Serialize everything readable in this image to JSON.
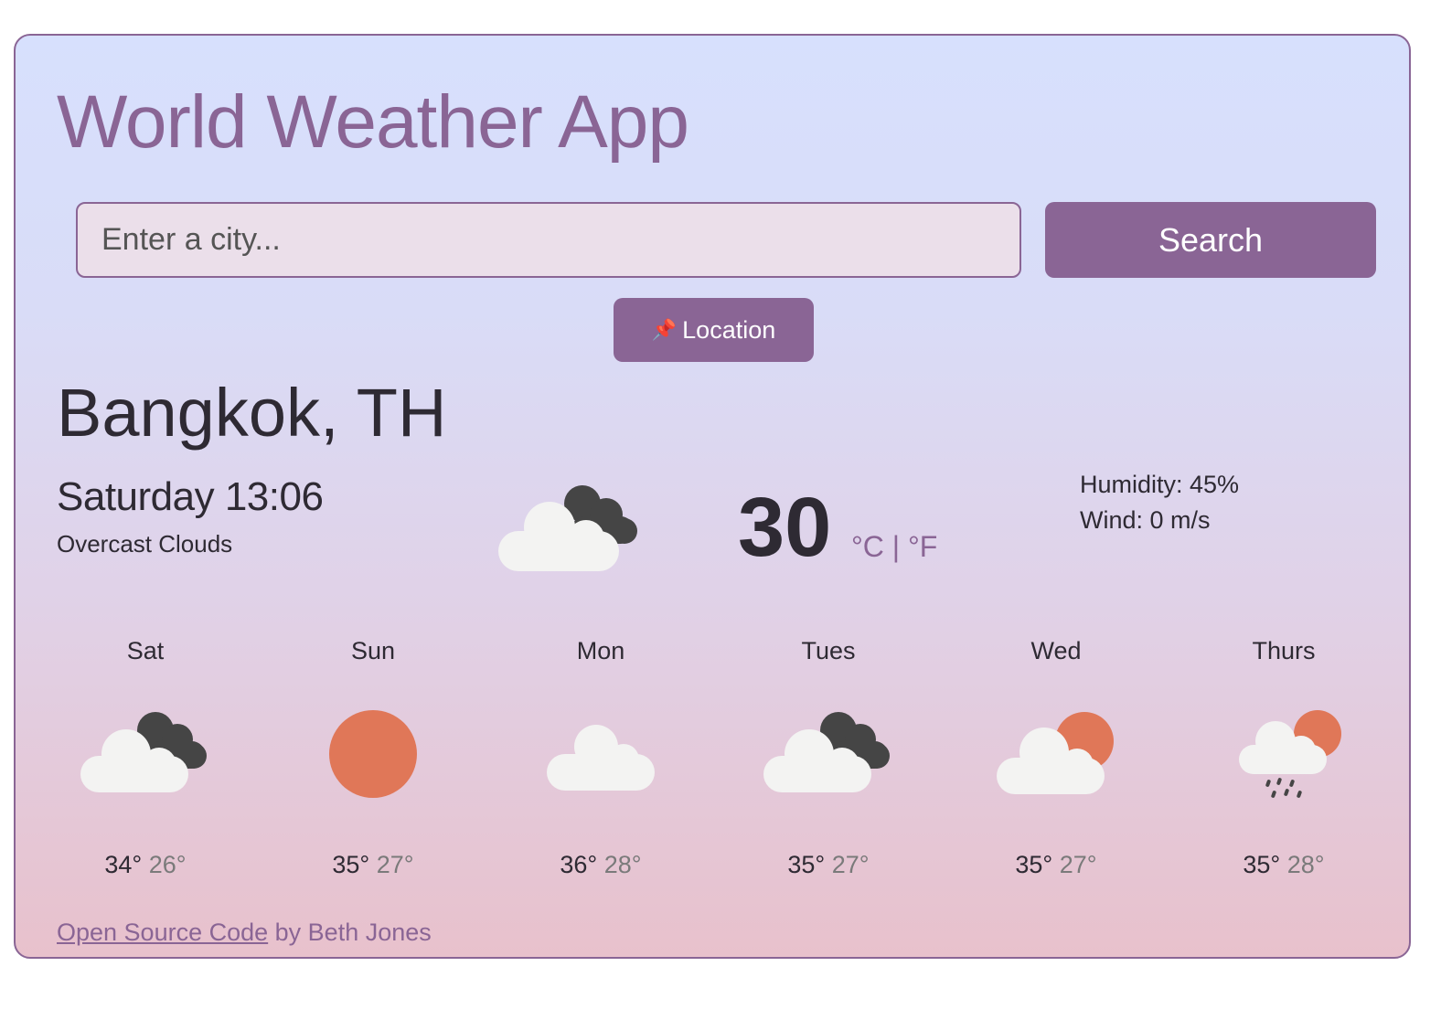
{
  "app": {
    "title": "World Weather App"
  },
  "search": {
    "placeholder": "Enter a city...",
    "button_label": "Search"
  },
  "location": {
    "button_label": "Location",
    "icon": "pushpin-icon"
  },
  "current": {
    "city": "Bangkok, TH",
    "datetime": "Saturday 13:06",
    "description": "Overcast Clouds",
    "temperature": "30",
    "units": "°C | °F",
    "humidity": "Humidity: 45%",
    "wind": "Wind: 0 m/s",
    "icon": "dark-cloud-icon"
  },
  "forecast": [
    {
      "day": "Sat",
      "max": "34°",
      "min": "26°",
      "icon": "dark-cloud-icon"
    },
    {
      "day": "Sun",
      "max": "35°",
      "min": "27°",
      "icon": "sun-icon"
    },
    {
      "day": "Mon",
      "max": "36°",
      "min": "28°",
      "icon": "cloud-icon"
    },
    {
      "day": "Tues",
      "max": "35°",
      "min": "27°",
      "icon": "dark-cloud-icon"
    },
    {
      "day": "Wed",
      "max": "35°",
      "min": "27°",
      "icon": "sun-cloud-icon"
    },
    {
      "day": "Thurs",
      "max": "35°",
      "min": "28°",
      "icon": "rain-sun-icon"
    }
  ],
  "footer": {
    "link_text": "Open Source Code",
    "suffix": " by Beth Jones"
  },
  "colors": {
    "accent": "#8a6595",
    "sun": "#e07758",
    "dark_cloud": "#454545",
    "light_cloud": "#f3f3f2"
  }
}
